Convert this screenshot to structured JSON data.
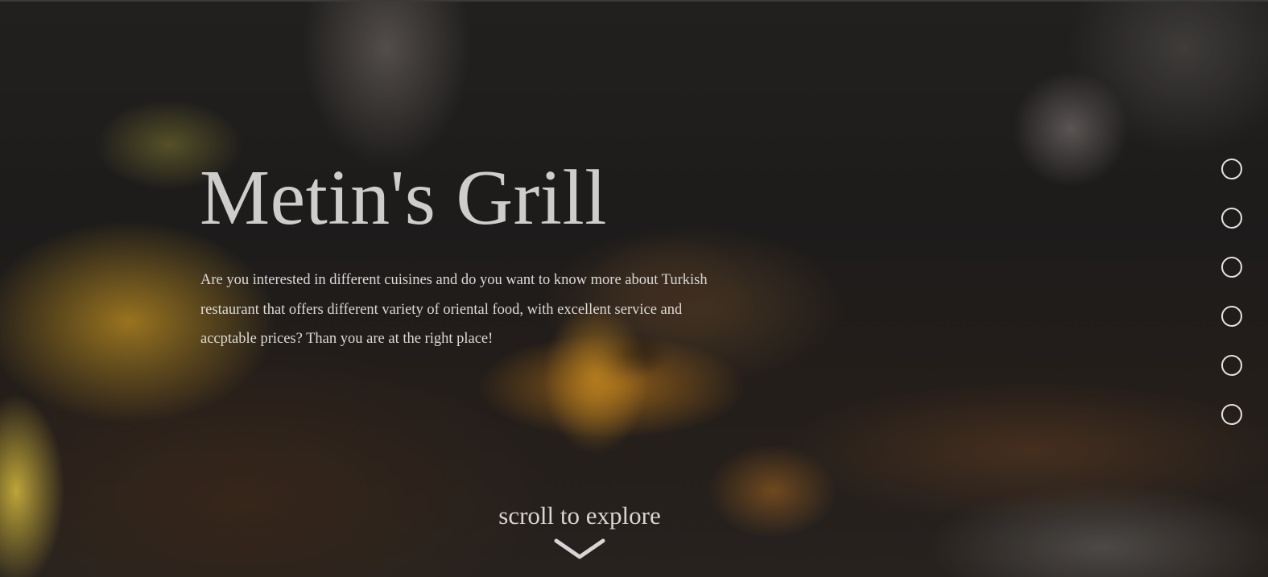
{
  "hero": {
    "title": "Metin's Grill",
    "description": "Are you interested in different cuisines and do you want to know more about Turkish restaurant that offers different variety of oriental food, with excellent service and accptable prices? Than you are at the right place!",
    "scroll_label": "scroll to explore"
  },
  "section_nav": {
    "dots": [
      "section-1",
      "section-2",
      "section-3",
      "section-4",
      "section-5",
      "section-6"
    ],
    "active_index": null
  },
  "icons": {
    "scroll": "chevron-down-icon",
    "nav_dot": "circle-outline-icon"
  },
  "colors": {
    "text": "#cfcdcb",
    "dot_border": "#e4e2e0"
  }
}
